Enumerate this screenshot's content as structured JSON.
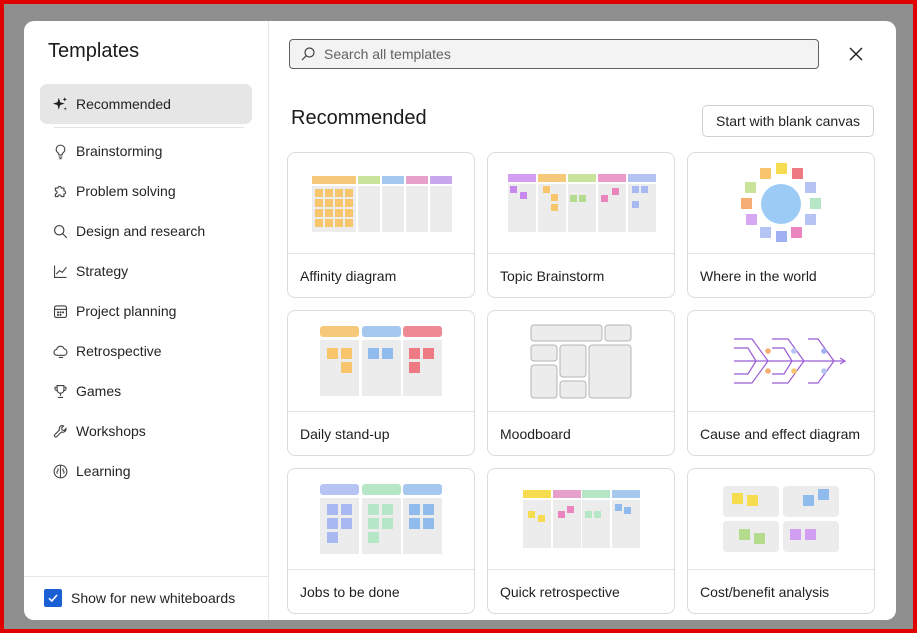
{
  "sidebar": {
    "title": "Templates",
    "items": [
      {
        "label": "Recommended",
        "icon": "sparkle-icon",
        "active": true
      },
      {
        "label": "Brainstorming",
        "icon": "lightbulb-icon"
      },
      {
        "label": "Problem solving",
        "icon": "puzzle-icon"
      },
      {
        "label": "Design and research",
        "icon": "search-icon"
      },
      {
        "label": "Strategy",
        "icon": "line-chart-icon"
      },
      {
        "label": "Project planning",
        "icon": "calendar-icon"
      },
      {
        "label": "Retrospective",
        "icon": "cloud-icon"
      },
      {
        "label": "Games",
        "icon": "trophy-icon"
      },
      {
        "label": "Workshops",
        "icon": "wrench-icon"
      },
      {
        "label": "Learning",
        "icon": "brain-icon"
      }
    ],
    "footer": {
      "checkbox_label": "Show for new whiteboards",
      "checked": true
    }
  },
  "search": {
    "placeholder": "Search all templates"
  },
  "main": {
    "title": "Recommended",
    "blank_button": "Start with blank canvas",
    "cards": [
      {
        "label": "Affinity diagram"
      },
      {
        "label": "Topic Brainstorm"
      },
      {
        "label": "Where in the world"
      },
      {
        "label": "Daily stand-up"
      },
      {
        "label": "Moodboard"
      },
      {
        "label": "Cause and effect diagram"
      },
      {
        "label": "Jobs to be done"
      },
      {
        "label": "Quick retrospective"
      },
      {
        "label": "Cost/benefit analysis"
      }
    ]
  },
  "colors": {
    "frame": "#e00000",
    "overlay": "#8f8f8f",
    "accent": "#1a5fd4",
    "active_nav": "#e6e6e6"
  }
}
